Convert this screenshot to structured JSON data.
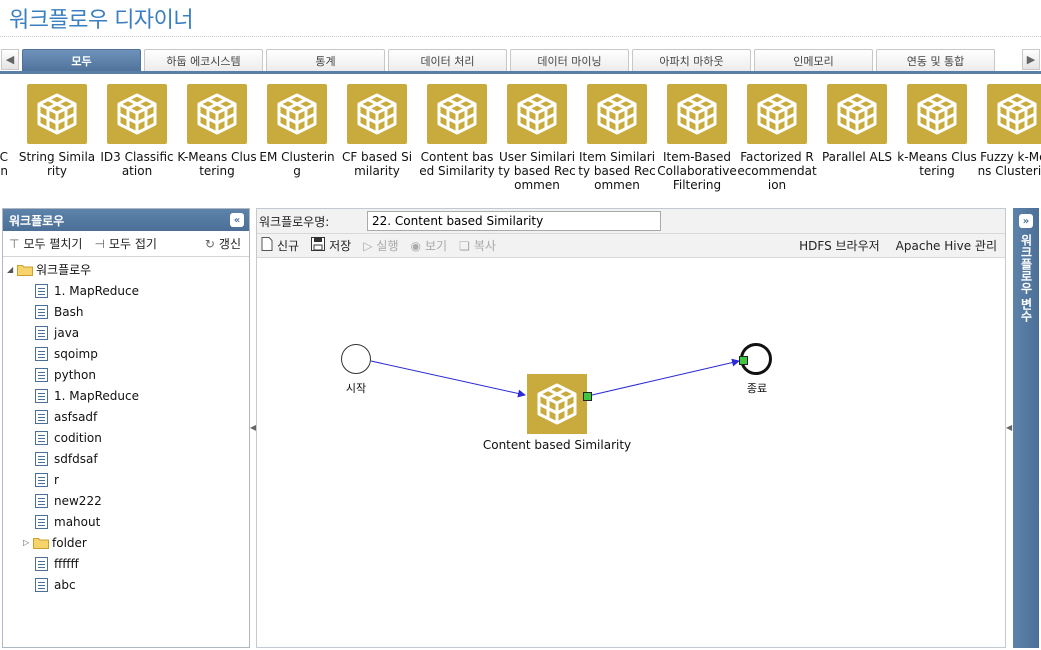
{
  "app": {
    "title": "워크플로우 디자이너"
  },
  "tabs": [
    {
      "label": "모두",
      "active": true
    },
    {
      "label": "하둡 에코시스템"
    },
    {
      "label": "통계"
    },
    {
      "label": "데이터 처리"
    },
    {
      "label": "데이터 마이닝"
    },
    {
      "label": "아파치 마하웃"
    },
    {
      "label": "인메모리"
    },
    {
      "label": "연동 및 통합"
    }
  ],
  "palette": {
    "partial_label": "C\nn",
    "items": [
      {
        "label": "String Similarity"
      },
      {
        "label": "ID3 Classification"
      },
      {
        "label": "K-Means Clustering"
      },
      {
        "label": "EM Clustering"
      },
      {
        "label": "CF based Similarity"
      },
      {
        "label": "Content based Similarity"
      },
      {
        "label": "User Similarity based Recommen"
      },
      {
        "label": "Item Similarity based Recommen"
      },
      {
        "label": "Item-Based Collaborative Filtering"
      },
      {
        "label": "Factorized Recommendation"
      },
      {
        "label": "Parallel ALS"
      },
      {
        "label": "k-Means Clustering"
      },
      {
        "label": "Fuzzy k-Means Clustering"
      }
    ],
    "icon_color": "#c9aa3c"
  },
  "left_panel": {
    "title": "워크플로우",
    "toolbar": {
      "expand_all": "모두 펼치기",
      "collapse_all": "모두 접기",
      "refresh": "갱신"
    },
    "root": "워크플로우",
    "items": [
      {
        "label": "1. MapReduce",
        "type": "file"
      },
      {
        "label": "Bash",
        "type": "file"
      },
      {
        "label": "java",
        "type": "file"
      },
      {
        "label": "sqoimp",
        "type": "file"
      },
      {
        "label": "python",
        "type": "file"
      },
      {
        "label": "1. MapReduce",
        "type": "file"
      },
      {
        "label": "asfsadf",
        "type": "file"
      },
      {
        "label": "codition",
        "type": "file"
      },
      {
        "label": "sdfdsaf",
        "type": "file"
      },
      {
        "label": "r",
        "type": "file"
      },
      {
        "label": "new222",
        "type": "file"
      },
      {
        "label": "mahout",
        "type": "file"
      },
      {
        "label": "folder",
        "type": "folder"
      },
      {
        "label": "ffffff",
        "type": "file"
      },
      {
        "label": "abc",
        "type": "file"
      }
    ]
  },
  "main": {
    "name_label": "워크플로우명:",
    "name_value": "22. Content based Similarity",
    "toolbar": {
      "new": "신규",
      "save": "저장",
      "run": "실행",
      "view": "보기",
      "copy": "복사",
      "hdfs_browser": "HDFS 브라우저",
      "hive_admin": "Apache Hive 관리"
    },
    "canvas": {
      "start_label": "시작",
      "end_label": "종료",
      "action_label": "Content based Similarity"
    }
  },
  "right_panel": {
    "title": "워크플로우 변수"
  },
  "colors": {
    "accent": "#4b6f97",
    "title": "#3a7fc1",
    "node": "#c9aa3c",
    "edge": "#2a2ad6",
    "port": "#3ec83e"
  }
}
